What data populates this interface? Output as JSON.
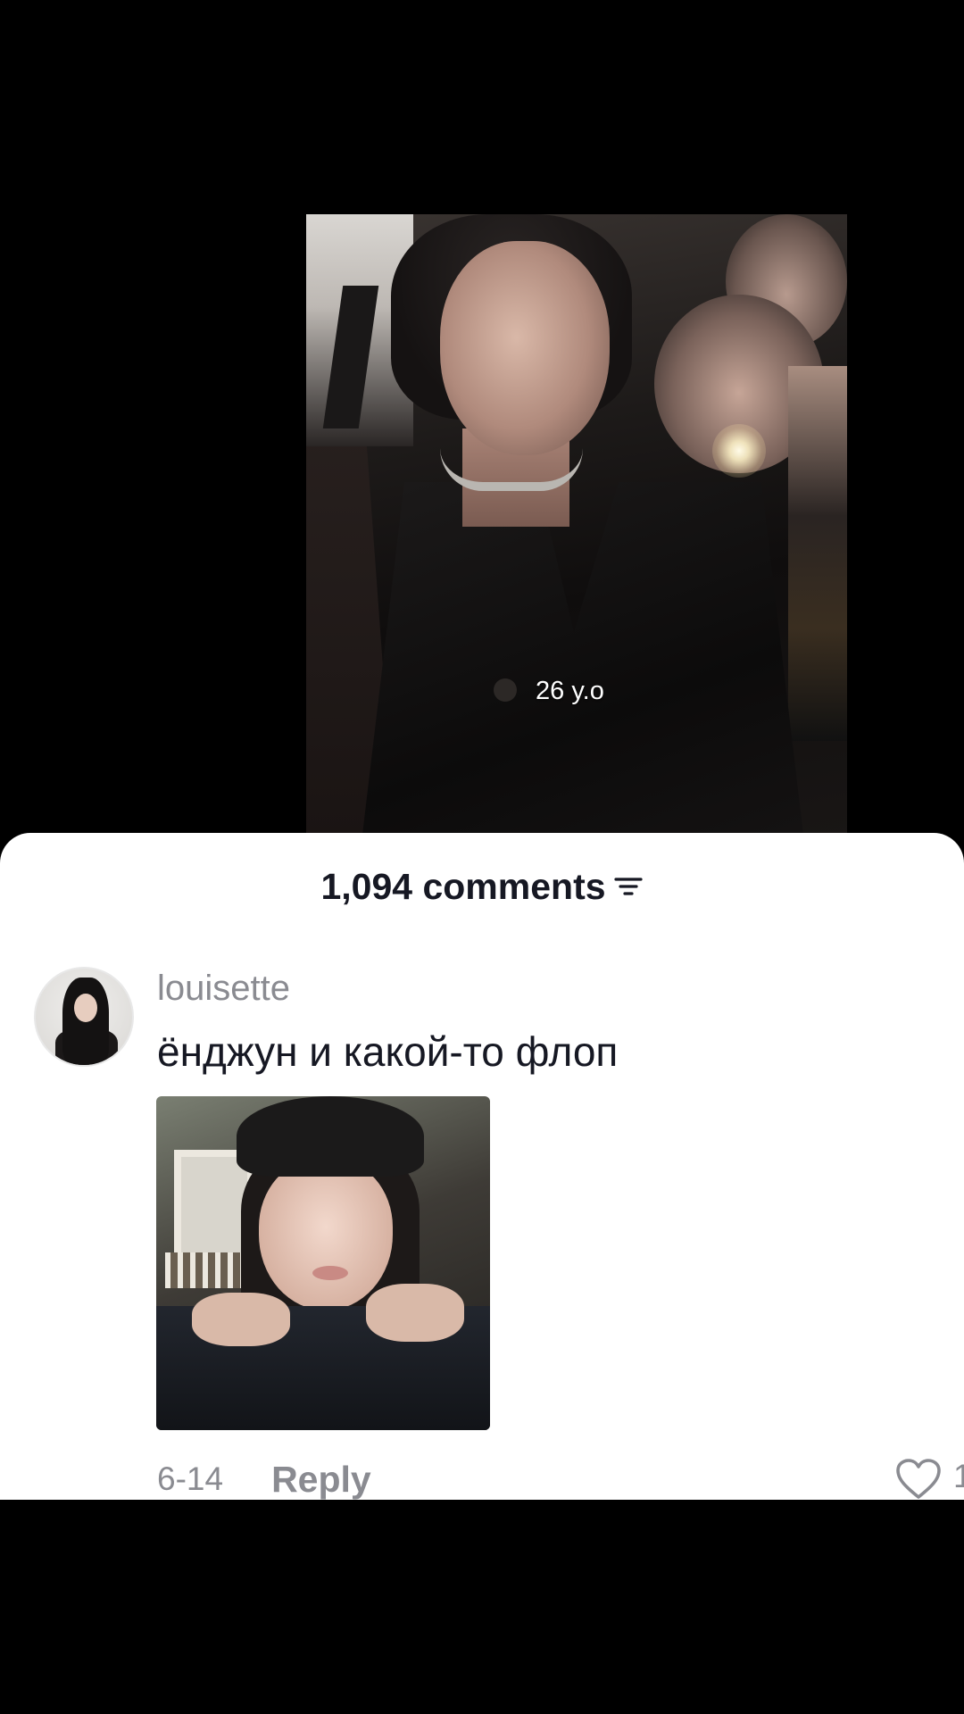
{
  "video": {
    "caption": "26 y.o"
  },
  "comments_sheet": {
    "count_label": "1,094 comments",
    "filter_icon": "filter-icon"
  },
  "comment": {
    "username": "louisette",
    "text": "ёнджун и какой-то флоп",
    "date": "6-14",
    "reply_label": "Reply",
    "like_count": "1",
    "like_icon": "heart-outline-icon"
  }
}
